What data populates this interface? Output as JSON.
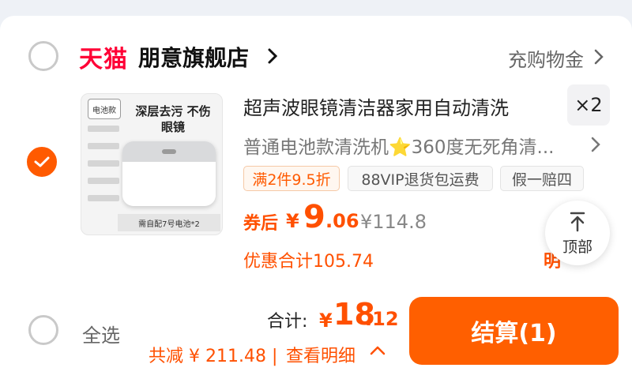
{
  "colors": {
    "accent": "#ff5a00",
    "brand_tmall": "#ff0036",
    "muted": "#777777"
  },
  "shop": {
    "logo_text": "天猫",
    "name": "朋意旗舰店",
    "coupon_link": "充购物金"
  },
  "item": {
    "thumbnail": {
      "tag_text": "电池款",
      "headline": "深层去污 不伤眼镜",
      "footer": "需自配7号电池*2"
    },
    "title": "超声波眼镜清洁器家用自动清洗",
    "quantity": "×2",
    "sku": "普通电池款清洗机⭐360度无死角清...",
    "tags": [
      "满2件9.5折",
      "88VIP退货包运费",
      "假一赔四"
    ],
    "after_coupon_label": "券后",
    "price_symbol": "¥",
    "price_integer": "9",
    "price_decimal": ".06",
    "original_price": "¥114.8",
    "discount_total": "优惠合计105.74",
    "partial_label": "明"
  },
  "floating": {
    "top_label": "顶部"
  },
  "footer": {
    "select_all": "全选",
    "total_label": "合计:",
    "total_symbol": "¥",
    "total_integer": "18",
    "total_decimal": ".12",
    "saved": "共减 ¥ 211.48 |",
    "details_link": "查看明细",
    "checkout": "结算(1)"
  }
}
